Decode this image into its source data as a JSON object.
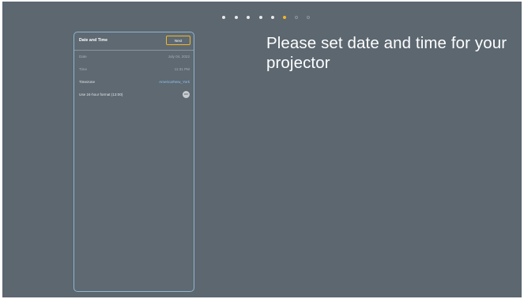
{
  "steps": {
    "states": [
      "done",
      "done",
      "done",
      "done",
      "done",
      "active",
      "todo",
      "todo"
    ],
    "colors": {
      "done": "#e6e8ea",
      "active": "#f2b724",
      "todo": "#8c959c"
    }
  },
  "panel": {
    "title": "Date and Time",
    "next_label": "Next",
    "rows": [
      {
        "label": "Date",
        "value": "July 04, 2022"
      },
      {
        "label": "Time",
        "value": "11:31 PM"
      },
      {
        "label": "Timezone",
        "value": "America/New_York"
      },
      {
        "label": "Use 24-hour format (13:00)",
        "toggle": "OFF"
      }
    ]
  },
  "prompt": {
    "text": "Please set date and time for your projector"
  },
  "colors": {
    "background": "#5c6770",
    "panel_border": "#8fb6cf",
    "accent": "#f2b724",
    "link": "#8ec3ee"
  }
}
